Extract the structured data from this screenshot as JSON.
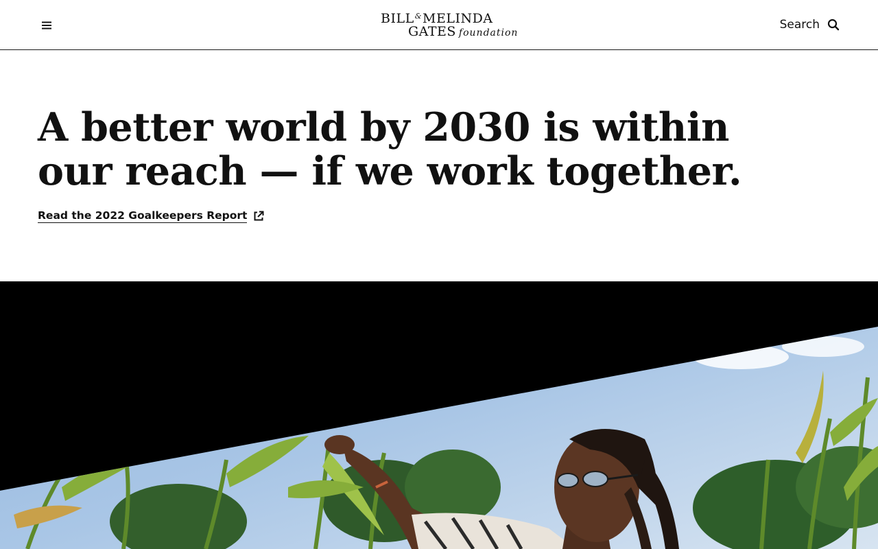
{
  "header": {
    "menu_icon": "hamburger-menu-icon",
    "logo": {
      "line1_left": "BILL",
      "line1_amp": "&",
      "line1_right": "MELINDA",
      "line2_main": "GATES",
      "line2_italic": "foundation"
    },
    "search_label": "Search",
    "search_icon": "search-icon"
  },
  "hero": {
    "title_line1": "A better world by 2030 is within",
    "title_line2": "our reach — if we work together.",
    "link_text": "Read the 2022 Goalkeepers Report",
    "link_icon": "external-link-icon"
  },
  "colors": {
    "text": "#111111",
    "background": "#ffffff",
    "photo_band": "#000000"
  }
}
